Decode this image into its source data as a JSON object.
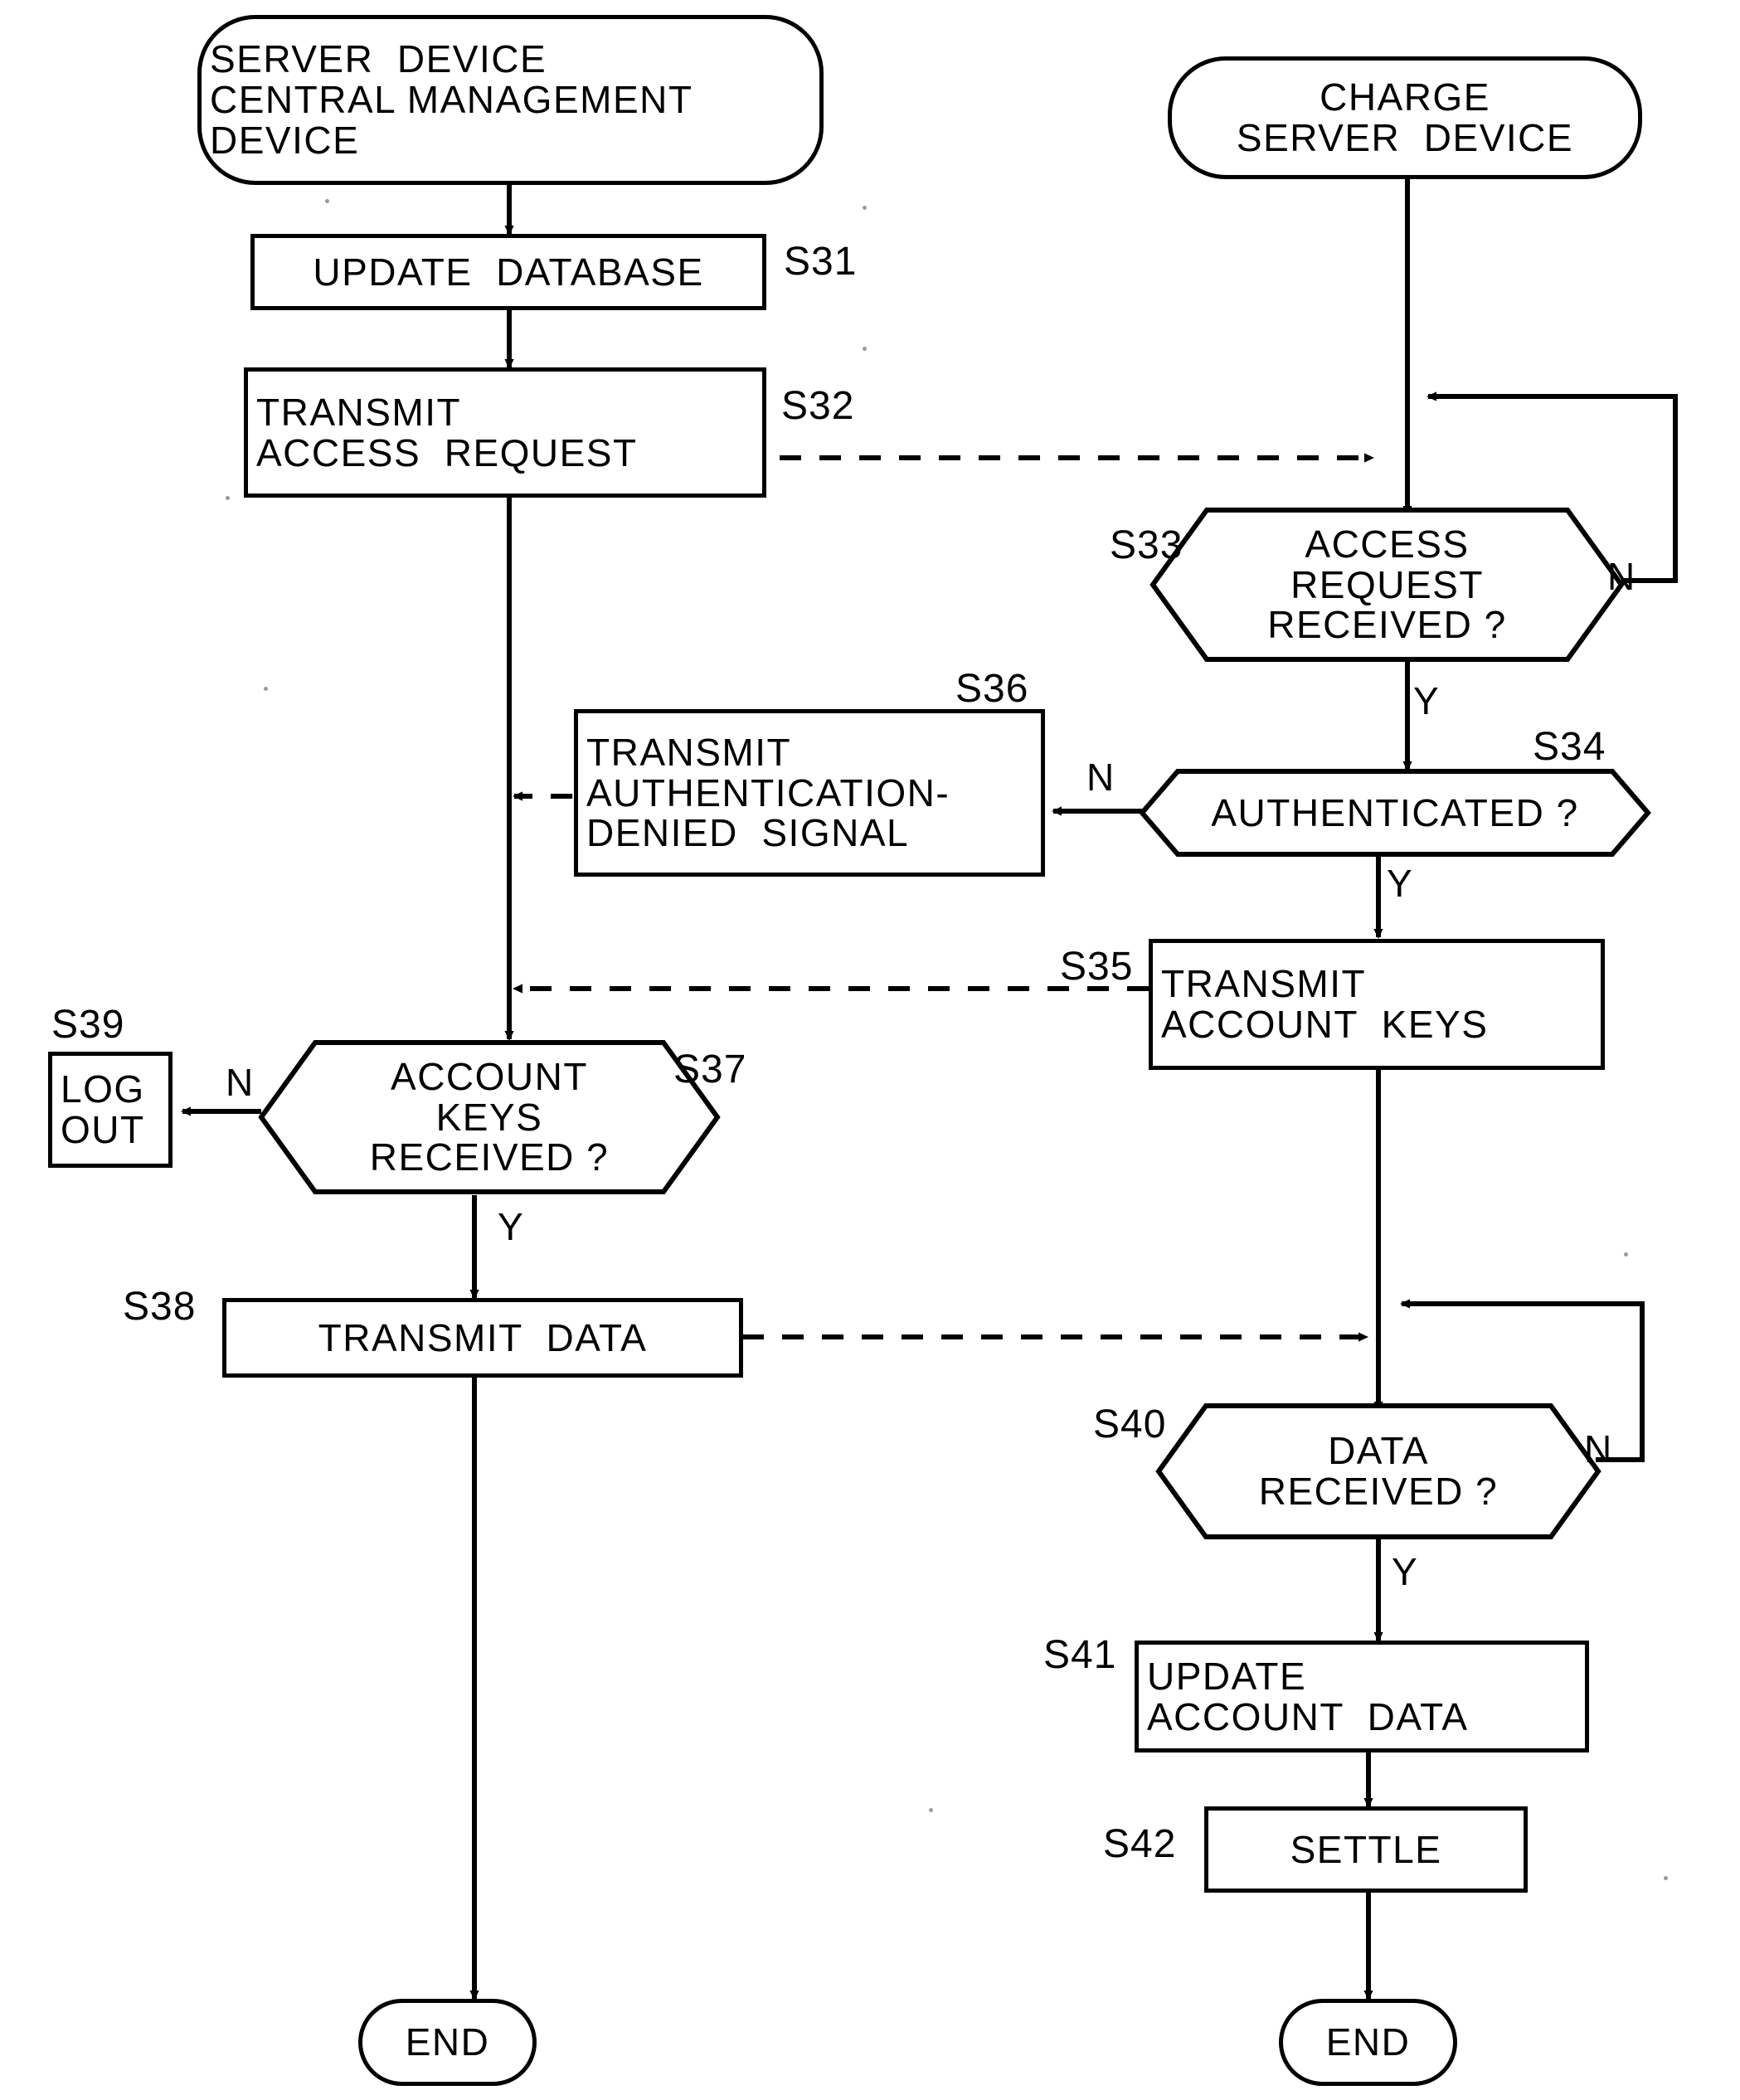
{
  "diagram": {
    "type": "flowchart",
    "title": "",
    "lanes": [
      {
        "name": "server-device-lane",
        "header": "SERVER DEVICE\nCENTRAL MANAGEMENT\nDEVICE"
      },
      {
        "name": "charge-server-lane",
        "header": "CHARGE\nSERVER DEVICE"
      }
    ],
    "nodes": {
      "start_left": {
        "label_l1": "SERVER  DEVICE",
        "label_l2": "CENTRAL MANAGEMENT",
        "label_l3": "DEVICE",
        "shape": "terminal"
      },
      "start_right": {
        "label_l1": "CHARGE",
        "label_l2": "SERVER  DEVICE",
        "shape": "terminal"
      },
      "s31": {
        "step": "S31",
        "label_l1": "UPDATE  DATABASE",
        "shape": "process"
      },
      "s32": {
        "step": "S32",
        "label_l1": "TRANSMIT",
        "label_l2": "ACCESS  REQUEST",
        "shape": "process"
      },
      "s33": {
        "step": "S33",
        "label_l1": "ACCESS",
        "label_l2": "REQUEST",
        "label_l3": "RECEIVED ?",
        "shape": "decision"
      },
      "s34": {
        "step": "S34",
        "label_l1": "AUTHENTICATED ?",
        "shape": "decision"
      },
      "s35": {
        "step": "S35",
        "label_l1": "TRANSMIT",
        "label_l2": "ACCOUNT  KEYS",
        "shape": "process"
      },
      "s36": {
        "step": "S36",
        "label_l1": "TRANSMIT",
        "label_l2": "AUTHENTICATION-",
        "label_l3": "DENIED  SIGNAL",
        "shape": "process"
      },
      "s37": {
        "step": "S37",
        "label_l1": "ACCOUNT",
        "label_l2": "KEYS",
        "label_l3": "RECEIVED ?",
        "shape": "decision"
      },
      "s38": {
        "step": "S38",
        "label_l1": "TRANSMIT  DATA",
        "shape": "process"
      },
      "s39": {
        "step": "S39",
        "label_l1": "LOG",
        "label_l2": "OUT",
        "shape": "process"
      },
      "s40": {
        "step": "S40",
        "label_l1": "DATA",
        "label_l2": "RECEIVED ?",
        "shape": "decision"
      },
      "s41": {
        "step": "S41",
        "label_l1": "UPDATE",
        "label_l2": "ACCOUNT  DATA",
        "shape": "process"
      },
      "s42": {
        "step": "S42",
        "label_l1": "SETTLE",
        "shape": "process"
      },
      "end_left": {
        "label_l1": "END",
        "shape": "terminal"
      },
      "end_right": {
        "label_l1": "END",
        "shape": "terminal"
      }
    },
    "edge_labels": {
      "s33_no": "N",
      "s33_yes": "Y",
      "s34_no": "N",
      "s34_yes": "Y",
      "s37_no": "N",
      "s37_yes": "Y",
      "s40_no": "N",
      "s40_yes": "Y"
    },
    "colors": {
      "stroke": "#000000",
      "background": "#ffffff"
    }
  }
}
